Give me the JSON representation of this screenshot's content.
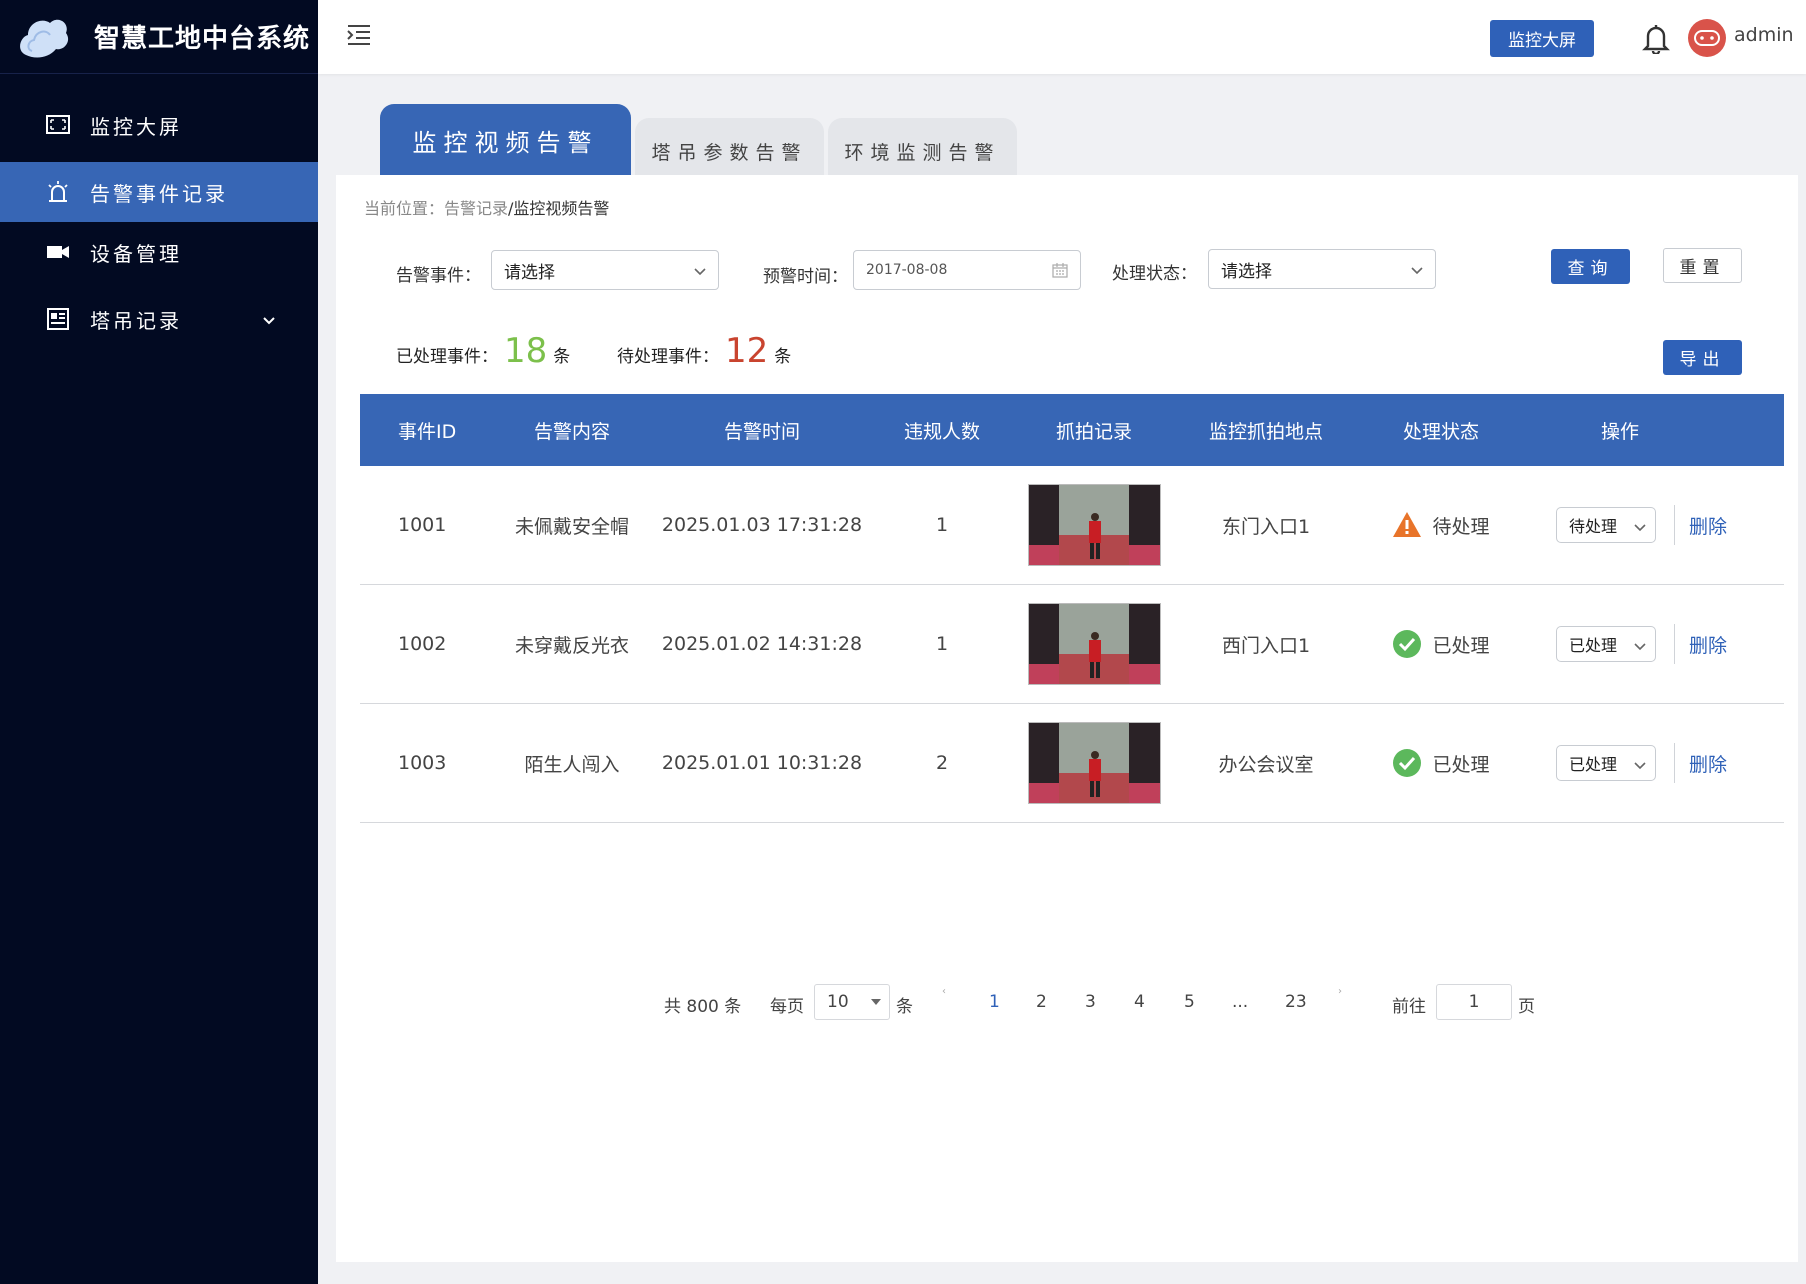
{
  "app": {
    "title": "智慧工地中台系统"
  },
  "sidebar": {
    "items": [
      {
        "label": "监控大屏",
        "icon": "screen-icon"
      },
      {
        "label": "告警事件记录",
        "icon": "alarm-icon",
        "active": true
      },
      {
        "label": "设备管理",
        "icon": "camera-icon"
      },
      {
        "label": "塔吊记录",
        "icon": "grid-icon",
        "expandable": true
      }
    ]
  },
  "header": {
    "monitor_button": "监控大屏",
    "username": "admin"
  },
  "tabs": [
    "监控视频告警",
    "塔吊参数告警",
    "环境监测告警"
  ],
  "breadcrumb": {
    "prefix": "当前位置：",
    "parent": "告警记录",
    "current": "/监控视频告警"
  },
  "filters": {
    "event_label": "告警事件：",
    "event_value": "请选择",
    "time_label": "预警时间：",
    "time_value": "2017-08-08",
    "status_label": "处理状态：",
    "status_value": "请选择",
    "query_button": "查询",
    "reset_button": "重置",
    "export_button": "导出"
  },
  "stats": {
    "processed_label": "已处理事件：",
    "processed_count": "18",
    "pending_label": "待处理事件：",
    "pending_count": "12",
    "unit": "条"
  },
  "table": {
    "headers": [
      "事件ID",
      "告警内容",
      "告警时间",
      "违规人数",
      "抓拍记录",
      "监控抓拍地点",
      "处理状态",
      "操作"
    ],
    "rows": [
      {
        "id": "1001",
        "content": "未佩戴安全帽",
        "time": "2025.01.03  17:31:28",
        "count": "1",
        "location": "东门入口1",
        "status": "待处理",
        "status_type": "warning",
        "op_value": "待处理",
        "delete": "删除"
      },
      {
        "id": "1002",
        "content": "未穿戴反光衣",
        "time": "2025.01.02  14:31:28",
        "count": "1",
        "location": "西门入口1",
        "status": "已处理",
        "status_type": "success",
        "op_value": "已处理",
        "delete": "删除"
      },
      {
        "id": "1003",
        "content": "陌生人闯入",
        "time": "2025.01.01  10:31:28",
        "count": "2",
        "location": "办公会议室",
        "status": "已处理",
        "status_type": "success",
        "op_value": "已处理",
        "delete": "删除"
      }
    ]
  },
  "pagination": {
    "total_text": "共 800 条",
    "per_page_label": "每页",
    "per_page_value": "10",
    "per_page_unit": "条",
    "pages": [
      "1",
      "2",
      "3",
      "4",
      "5",
      "...",
      "23"
    ],
    "current_page": "1",
    "goto_label": "前往",
    "goto_value": "1",
    "goto_unit": "页"
  },
  "colors": {
    "sidebar_bg": "#020a22",
    "accent": "#3766b5",
    "warning": "#e8742a",
    "success": "#5cb85c",
    "processed": "#7cc04b",
    "pending": "#c9442f"
  }
}
